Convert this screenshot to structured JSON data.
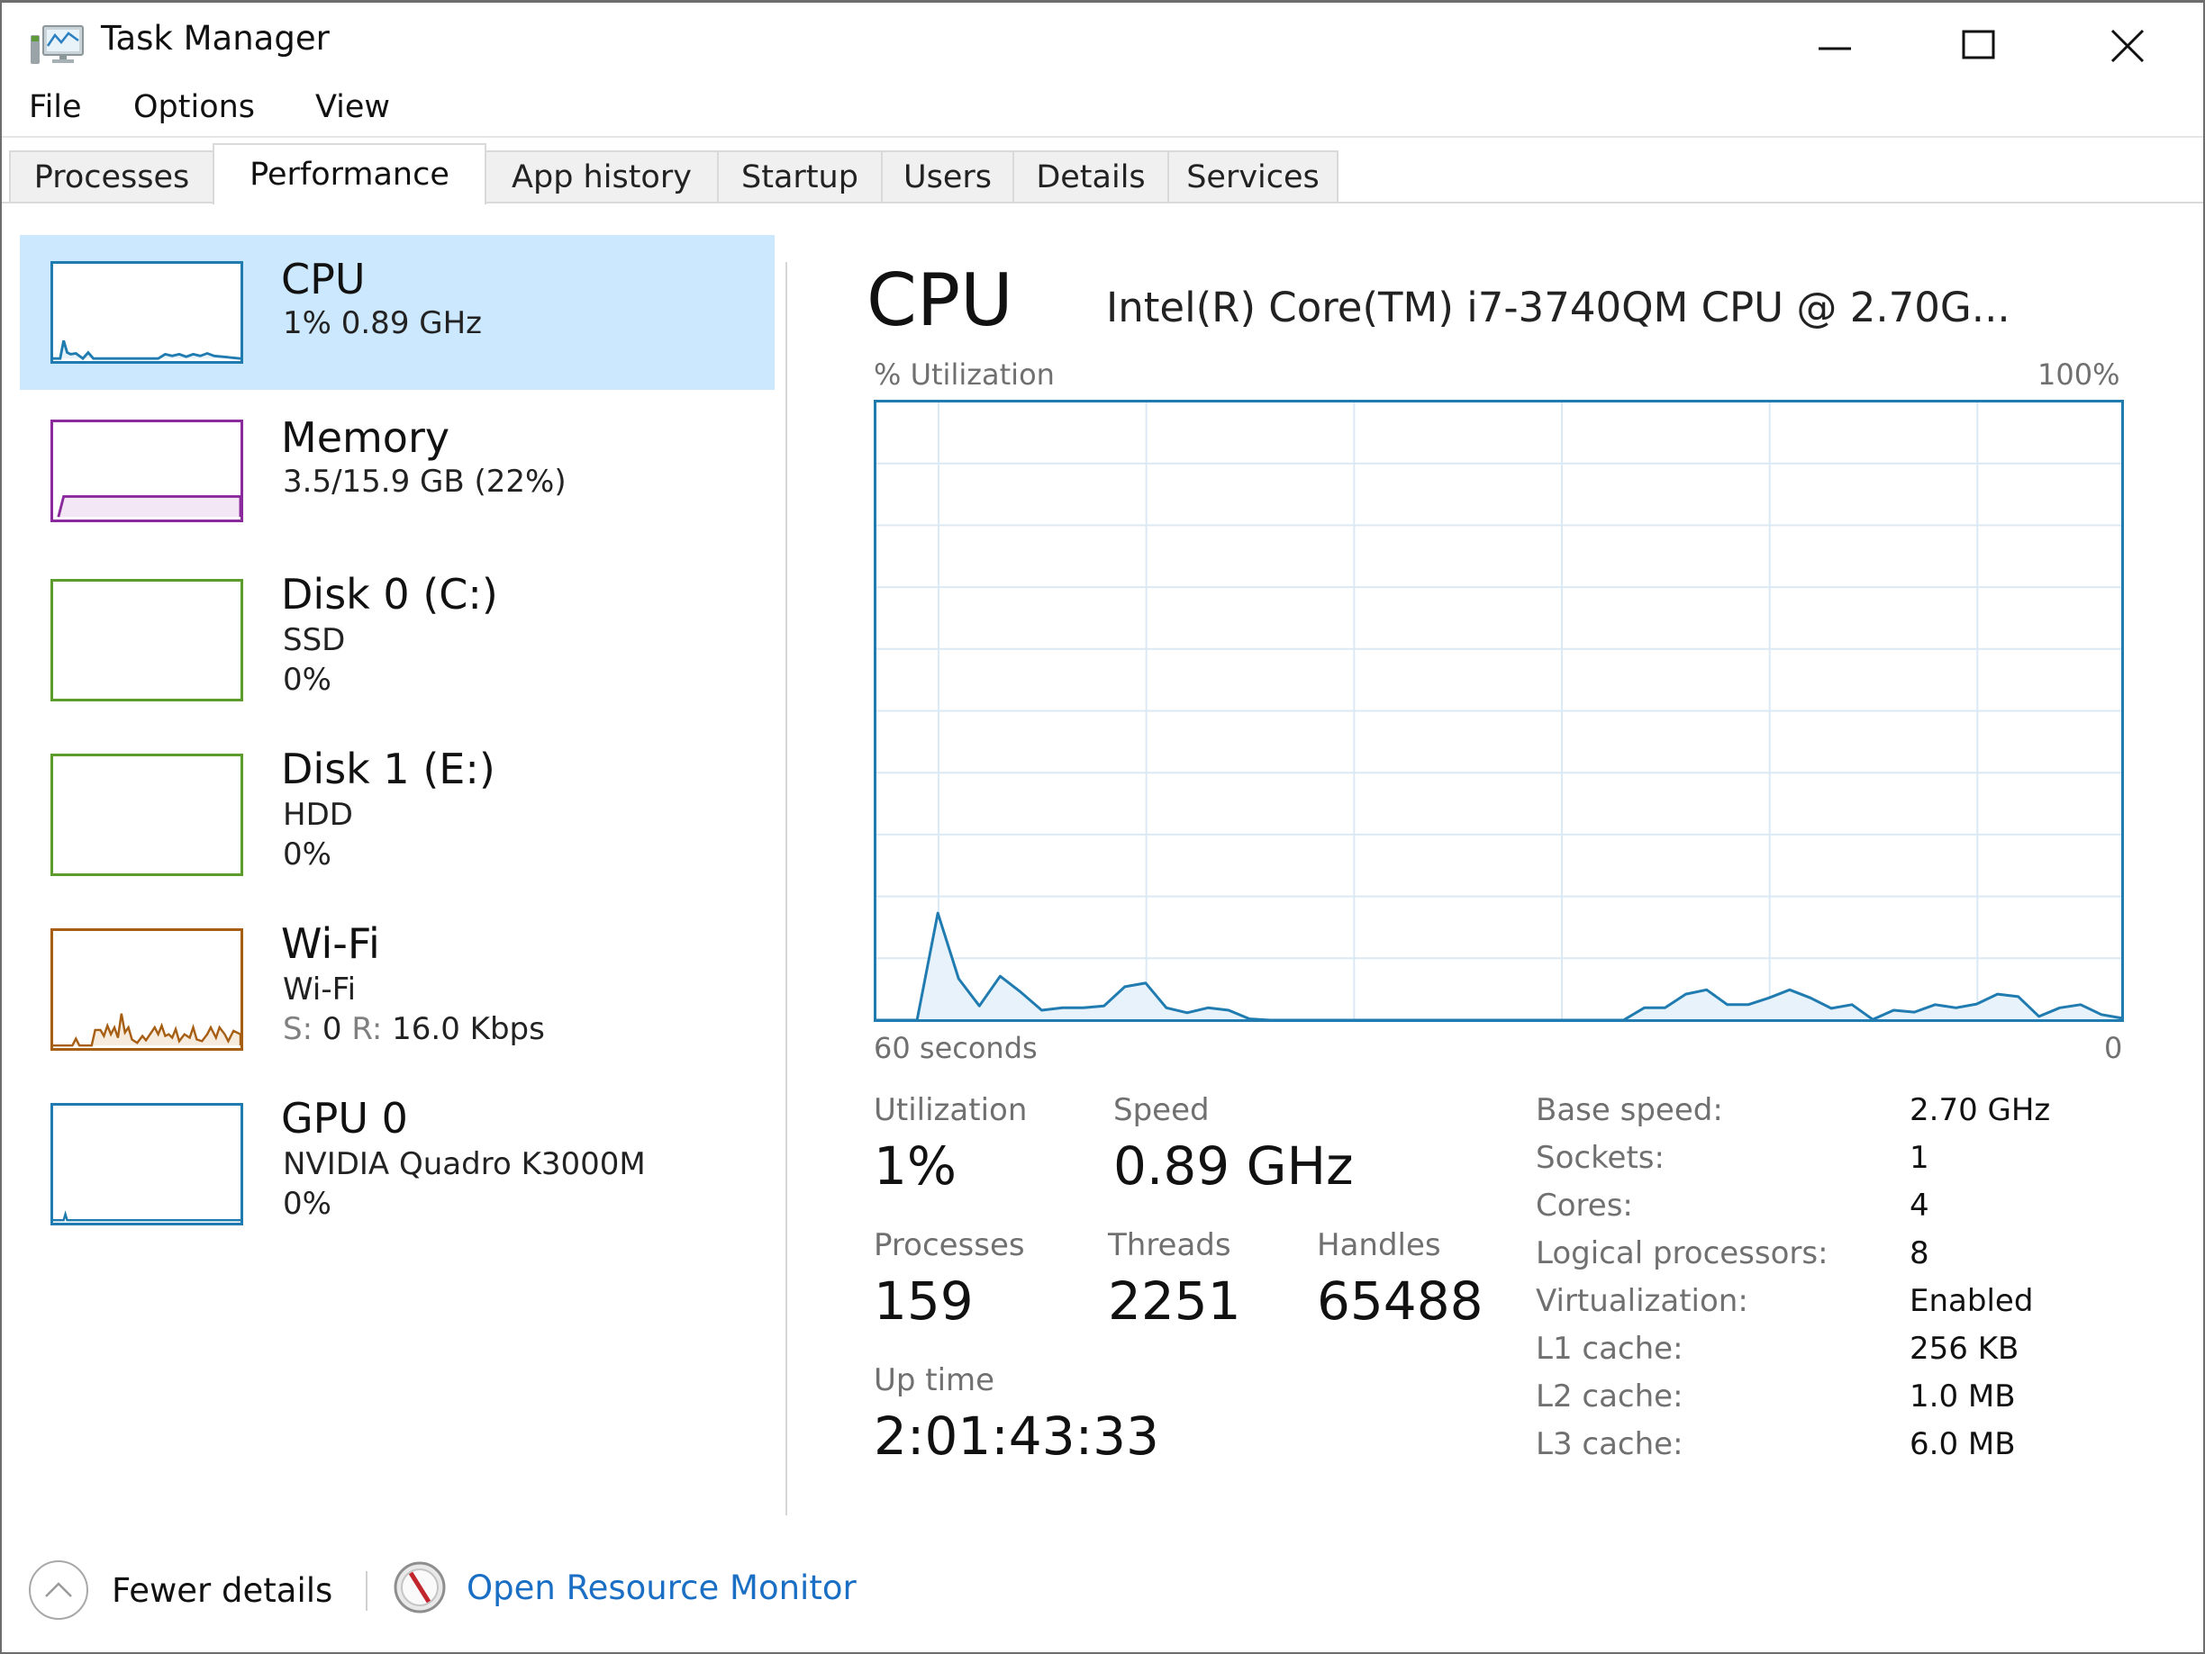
{
  "window": {
    "title": "Task Manager",
    "icon": "task-manager-icon",
    "controls": {
      "minimize": "minimize-icon",
      "maximize": "maximize-icon",
      "close": "close-icon"
    }
  },
  "menu": [
    "File",
    "Options",
    "View"
  ],
  "tabs": [
    {
      "label": "Processes",
      "active": false
    },
    {
      "label": "Performance",
      "active": true
    },
    {
      "label": "App history",
      "active": false
    },
    {
      "label": "Startup",
      "active": false
    },
    {
      "label": "Users",
      "active": false
    },
    {
      "label": "Details",
      "active": false
    },
    {
      "label": "Services",
      "active": false
    }
  ],
  "sidebar": {
    "items": [
      {
        "name": "CPU",
        "line1": "1% 0.89 GHz",
        "line2": "",
        "color": "#1f7bb0",
        "selected": true
      },
      {
        "name": "Memory",
        "line1": "3.5/15.9 GB (22%)",
        "line2": "",
        "color": "#8b2a9d",
        "selected": false,
        "fill_percent": 22
      },
      {
        "name": "Disk 0 (C:)",
        "line1": "SSD",
        "line2": "0%",
        "color": "#5e9b2d",
        "selected": false
      },
      {
        "name": "Disk 1 (E:)",
        "line1": "HDD",
        "line2": "0%",
        "color": "#5e9b2d",
        "selected": false
      },
      {
        "name": "Wi-Fi",
        "line1": "Wi-Fi",
        "line2_send_label": "S:",
        "line2_send_value": "0",
        "line2_recv_label": "R:",
        "line2_recv_value": "16.0 Kbps",
        "color": "#a65e12",
        "selected": false
      },
      {
        "name": "GPU 0",
        "line1": "NVIDIA Quadro K3000M",
        "line2": "0%",
        "color": "#1f7bb0",
        "selected": false
      }
    ]
  },
  "main": {
    "title": "CPU",
    "model": "Intel(R) Core(TM) i7-3740QM CPU @ 2.70G...",
    "stats": {
      "utilization_label": "Utilization",
      "utilization_value": "1%",
      "speed_label": "Speed",
      "speed_value": "0.89 GHz",
      "processes_label": "Processes",
      "processes_value": "159",
      "threads_label": "Threads",
      "threads_value": "2251",
      "handles_label": "Handles",
      "handles_value": "65488",
      "uptime_label": "Up time",
      "uptime_value": "2:01:43:33"
    },
    "info": [
      {
        "label": "Base speed:",
        "value": "2.70 GHz"
      },
      {
        "label": "Sockets:",
        "value": "1"
      },
      {
        "label": "Cores:",
        "value": "4"
      },
      {
        "label": "Logical processors:",
        "value": "8"
      },
      {
        "label": "Virtualization:",
        "value": "Enabled"
      },
      {
        "label": "L1 cache:",
        "value": "256 KB"
      },
      {
        "label": "L2 cache:",
        "value": "1.0 MB"
      },
      {
        "label": "L3 cache:",
        "value": "6.0 MB"
      }
    ]
  },
  "chart_data": {
    "type": "area",
    "title": "% Utilization",
    "ylabel": "% Utilization",
    "y_max_label": "100%",
    "x_left_label": "60 seconds",
    "x_right_label": "0",
    "ylim": [
      0,
      100
    ],
    "xlim": [
      60,
      0
    ],
    "grid": true,
    "line_color": "#1f7bb0",
    "fill_color": "#e8f2fa",
    "grid_color": "#dbe9f4",
    "series": [
      {
        "name": "CPU utilization",
        "values": [
          0,
          0,
          0,
          17.3,
          6.7,
          2.3,
          7.1,
          4.5,
          1.6,
          2,
          2,
          2.3,
          5.4,
          6,
          2,
          1.2,
          2,
          1.6,
          0.2,
          0,
          0,
          0,
          0,
          0,
          0,
          0,
          0,
          0,
          0,
          0,
          0,
          0,
          0,
          0,
          0,
          0,
          0,
          2,
          2,
          4.2,
          4.9,
          2.5,
          2.5,
          3.6,
          4.9,
          3.6,
          1.9,
          2.5,
          0.1,
          1.6,
          1.3,
          2.5,
          2,
          2.6,
          4.2,
          3.8,
          0.6,
          2,
          2.5,
          0.9,
          0.3
        ]
      }
    ]
  },
  "footer": {
    "fewer_details": "Fewer details",
    "open_resource_monitor": "Open Resource Monitor"
  }
}
